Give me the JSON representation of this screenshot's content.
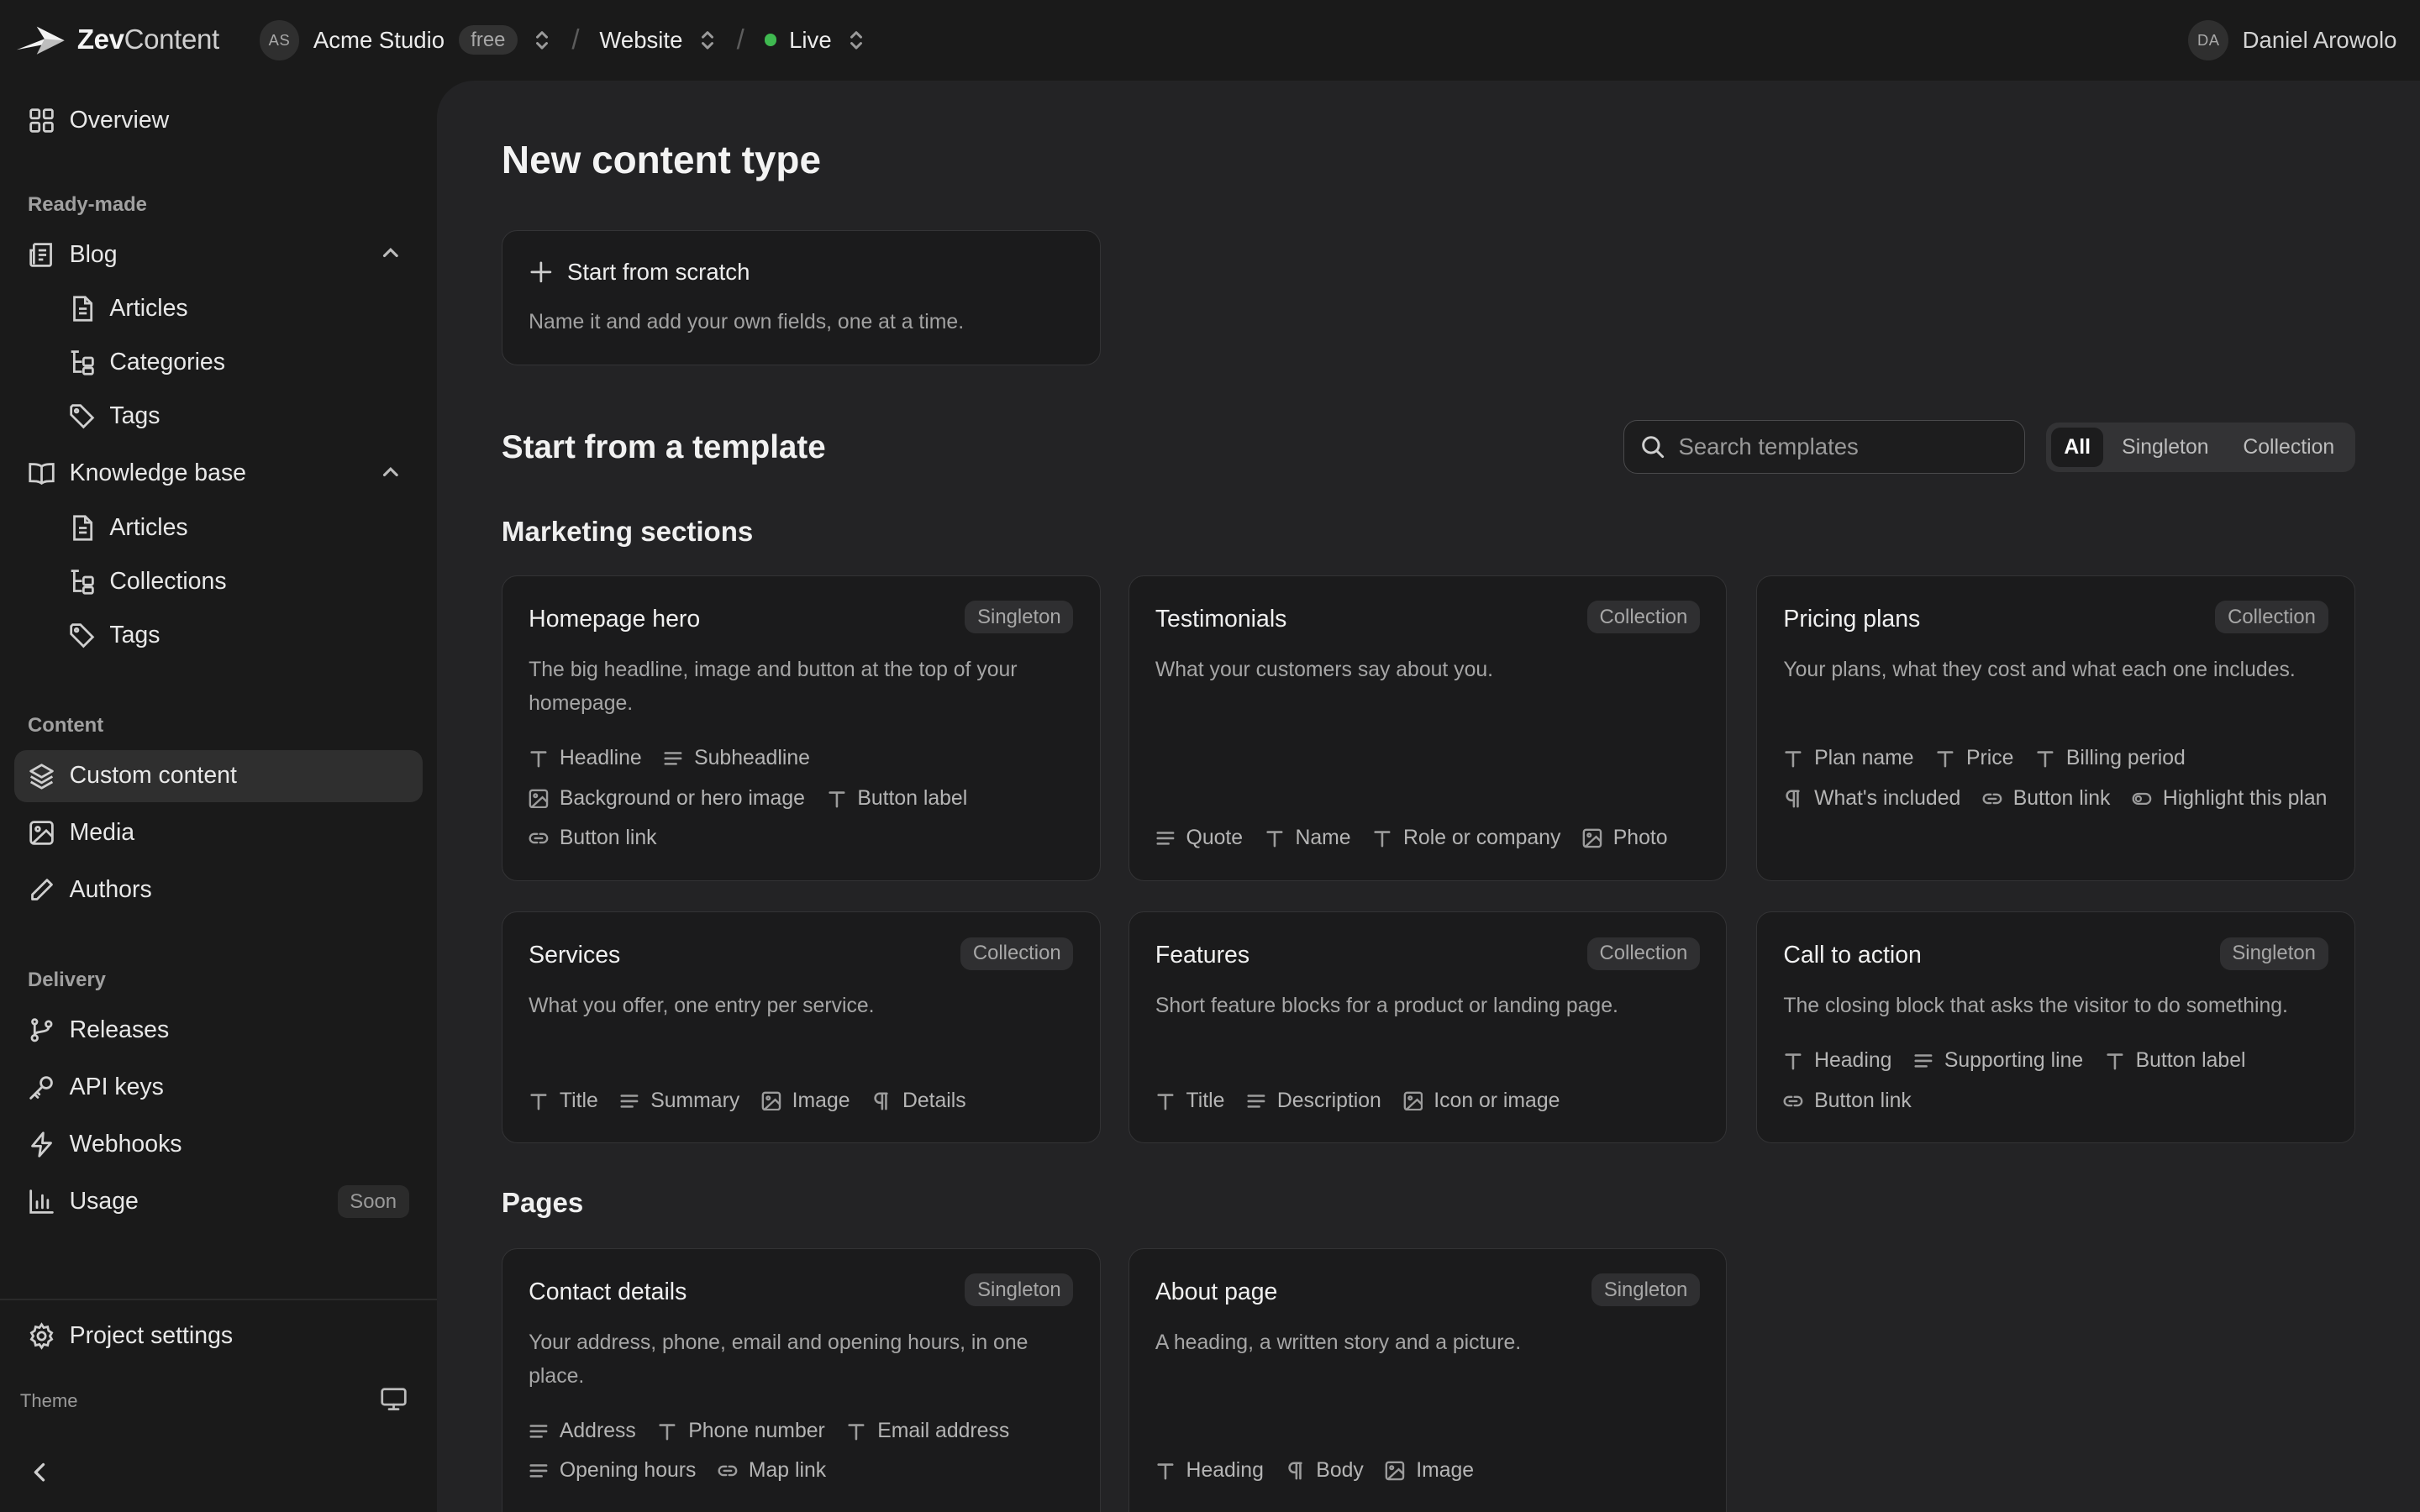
{
  "brand": {
    "name_bold": "Zev",
    "name_light": "Content"
  },
  "header": {
    "workspace_initials": "AS",
    "workspace": "Acme Studio",
    "plan": "free",
    "project": "Website",
    "environment": "Live",
    "user_initials": "DA",
    "user_name": "Daniel Arowolo"
  },
  "sidebar": {
    "overview": "Overview",
    "section_readymade": "Ready-made",
    "blog": "Blog",
    "blog_articles": "Articles",
    "blog_categories": "Categories",
    "blog_tags": "Tags",
    "kb": "Knowledge base",
    "kb_articles": "Articles",
    "kb_collections": "Collections",
    "kb_tags": "Tags",
    "section_content": "Content",
    "custom_content": "Custom content",
    "media": "Media",
    "authors": "Authors",
    "section_delivery": "Delivery",
    "releases": "Releases",
    "api_keys": "API keys",
    "webhooks": "Webhooks",
    "usage": "Usage",
    "usage_badge": "Soon",
    "project_settings": "Project settings",
    "theme": "Theme"
  },
  "main": {
    "title": "New content type",
    "scratch_title": "Start from scratch",
    "scratch_desc": "Name it and add your own fields, one at a time.",
    "template_heading": "Start from a template",
    "search_placeholder": "Search templates",
    "filters": [
      "All",
      "Singleton",
      "Collection"
    ],
    "group_marketing": "Marketing sections",
    "group_pages": "Pages"
  },
  "cards": [
    {
      "title": "Homepage hero",
      "badge": "Singleton",
      "desc": "The big headline, image and button at the top of your homepage.",
      "fields": [
        {
          "icon": "text",
          "label": "Headline"
        },
        {
          "icon": "lines",
          "label": "Subheadline"
        },
        {
          "icon": "image",
          "label": "Background or hero image"
        },
        {
          "icon": "text",
          "label": "Button label"
        },
        {
          "icon": "link",
          "label": "Button link"
        }
      ]
    },
    {
      "title": "Testimonials",
      "badge": "Collection",
      "desc": "What your customers say about you.",
      "fields": [
        {
          "icon": "lines",
          "label": "Quote"
        },
        {
          "icon": "text",
          "label": "Name"
        },
        {
          "icon": "text",
          "label": "Role or company"
        },
        {
          "icon": "image",
          "label": "Photo"
        }
      ]
    },
    {
      "title": "Pricing plans",
      "badge": "Collection",
      "desc": "Your plans, what they cost and what each one includes.",
      "fields": [
        {
          "icon": "text",
          "label": "Plan name"
        },
        {
          "icon": "text",
          "label": "Price"
        },
        {
          "icon": "text",
          "label": "Billing period"
        },
        {
          "icon": "pilcrow",
          "label": "What's included"
        },
        {
          "icon": "link",
          "label": "Button link"
        },
        {
          "icon": "toggle",
          "label": "Highlight this plan"
        }
      ]
    },
    {
      "title": "Services",
      "badge": "Collection",
      "desc": "What you offer, one entry per service.",
      "fields": [
        {
          "icon": "text",
          "label": "Title"
        },
        {
          "icon": "lines",
          "label": "Summary"
        },
        {
          "icon": "image",
          "label": "Image"
        },
        {
          "icon": "pilcrow",
          "label": "Details"
        }
      ]
    },
    {
      "title": "Features",
      "badge": "Collection",
      "desc": "Short feature blocks for a product or landing page.",
      "fields": [
        {
          "icon": "text",
          "label": "Title"
        },
        {
          "icon": "lines",
          "label": "Description"
        },
        {
          "icon": "image",
          "label": "Icon or image"
        }
      ]
    },
    {
      "title": "Call to action",
      "badge": "Singleton",
      "desc": "The closing block that asks the visitor to do something.",
      "fields": [
        {
          "icon": "text",
          "label": "Heading"
        },
        {
          "icon": "lines",
          "label": "Supporting line"
        },
        {
          "icon": "text",
          "label": "Button label"
        },
        {
          "icon": "link",
          "label": "Button link"
        }
      ]
    },
    {
      "title": "Contact details",
      "badge": "Singleton",
      "desc": "Your address, phone, email and opening hours, in one place.",
      "fields": [
        {
          "icon": "lines",
          "label": "Address"
        },
        {
          "icon": "text",
          "label": "Phone number"
        },
        {
          "icon": "text",
          "label": "Email address"
        },
        {
          "icon": "lines",
          "label": "Opening hours"
        },
        {
          "icon": "link",
          "label": "Map link"
        }
      ]
    },
    {
      "title": "About page",
      "badge": "Singleton",
      "desc": "A heading, a written story and a picture.",
      "fields": [
        {
          "icon": "text",
          "label": "Heading"
        },
        {
          "icon": "pilcrow",
          "label": "Body"
        },
        {
          "icon": "image",
          "label": "Image"
        }
      ]
    }
  ]
}
